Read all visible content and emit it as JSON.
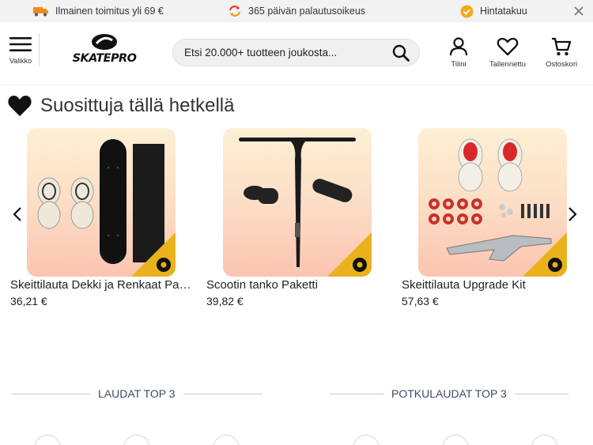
{
  "topbar": {
    "items": [
      {
        "text": "Ilmainen toimitus yli 69 €",
        "icon": "truck-icon"
      },
      {
        "text": "365 päivän palautusoikeus",
        "icon": "return-arrows-icon"
      },
      {
        "text": "Hintatakuu",
        "icon": "check-badge-icon"
      }
    ]
  },
  "header": {
    "menu_label": "Valikko",
    "logo_text": "SKATEPRO",
    "search_placeholder": "Etsi 20.000+ tuotteen joukosta...",
    "actions": [
      {
        "label": "Tilini",
        "icon": "user-icon"
      },
      {
        "label": "Tallennettu",
        "icon": "heart-icon"
      },
      {
        "label": "Ostoskori",
        "icon": "cart-icon"
      }
    ]
  },
  "section": {
    "title": "Suosittuja tällä hetkellä"
  },
  "products": [
    {
      "name": "Skeittilauta Dekki ja Renkaat Paketti",
      "price": "36,21 €"
    },
    {
      "name": "Scootin tanko Paketti",
      "price": "39,82 €"
    },
    {
      "name": "Skeittilauta Upgrade Kit",
      "price": "57,63 €"
    }
  ],
  "bottom_sections": [
    {
      "title": "LAUDAT TOP 3"
    },
    {
      "title": "POTKULAUDAT TOP 3"
    }
  ],
  "colors": {
    "accent_gold": "#e9b21c",
    "heading_blue": "#3d4a66",
    "badge_check": "#f0a81c",
    "return_red": "#e8402a",
    "truck_orange": "#f08c1e"
  }
}
